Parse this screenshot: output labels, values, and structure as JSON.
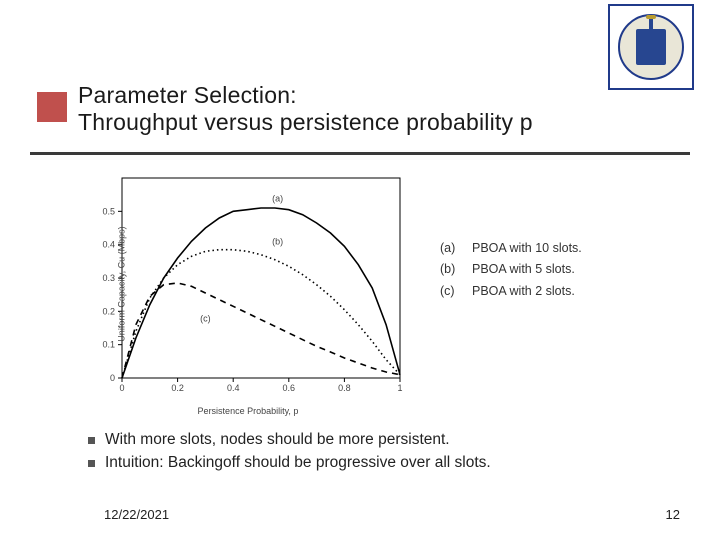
{
  "title_line1": "Parameter Selection:",
  "title_line2": "Throughput versus persistence probability p",
  "footer": {
    "date": "12/22/2021",
    "page": "12"
  },
  "bullets": [
    "With more slots, nodes should be more persistent.",
    "Intuition: Backingoff should be progressive over all slots."
  ],
  "legend": [
    {
      "key": "(a)",
      "text": "PBOA with 10 slots."
    },
    {
      "key": "(b)",
      "text": "PBOA with 5 slots."
    },
    {
      "key": "(c)",
      "text": "PBOA with 2 slots."
    }
  ],
  "chart_data": {
    "type": "line",
    "xlabel": "Persistence Probability, p",
    "ylabel": "Uniform Capacity, Cu (Mbps)",
    "xlim": [
      0,
      1
    ],
    "ylim": [
      0,
      0.6
    ],
    "xticks": [
      0,
      0.2,
      0.4,
      0.6,
      0.8,
      1
    ],
    "yticks": [
      0,
      0.1,
      0.2,
      0.3,
      0.4,
      0.5
    ],
    "inplot_labels": [
      {
        "text": "(a)",
        "x": 0.56,
        "y": 0.53
      },
      {
        "text": "(b)",
        "x": 0.56,
        "y": 0.4
      },
      {
        "text": "(c)",
        "x": 0.3,
        "y": 0.17
      }
    ],
    "series": [
      {
        "name": "(a) PBOA with 10 slots",
        "style": "solid",
        "x": [
          0.0,
          0.05,
          0.1,
          0.15,
          0.2,
          0.25,
          0.3,
          0.35,
          0.4,
          0.45,
          0.5,
          0.55,
          0.6,
          0.65,
          0.7,
          0.75,
          0.8,
          0.85,
          0.9,
          0.95,
          1.0
        ],
        "values": [
          0.0,
          0.12,
          0.22,
          0.3,
          0.36,
          0.41,
          0.45,
          0.48,
          0.5,
          0.505,
          0.51,
          0.51,
          0.505,
          0.49,
          0.465,
          0.435,
          0.395,
          0.34,
          0.27,
          0.16,
          0.01
        ]
      },
      {
        "name": "(b) PBOA with 5 slots",
        "style": "dotted",
        "x": [
          0.0,
          0.05,
          0.1,
          0.15,
          0.2,
          0.25,
          0.3,
          0.35,
          0.4,
          0.45,
          0.5,
          0.55,
          0.6,
          0.65,
          0.7,
          0.75,
          0.8,
          0.85,
          0.9,
          0.95,
          1.0
        ],
        "values": [
          0.0,
          0.14,
          0.24,
          0.3,
          0.34,
          0.365,
          0.38,
          0.385,
          0.385,
          0.38,
          0.37,
          0.355,
          0.335,
          0.31,
          0.28,
          0.245,
          0.205,
          0.16,
          0.11,
          0.055,
          0.01
        ]
      },
      {
        "name": "(c) PBOA with 2 slots",
        "style": "dashed",
        "x": [
          0.0,
          0.05,
          0.1,
          0.15,
          0.2,
          0.25,
          0.3,
          0.35,
          0.4,
          0.45,
          0.5,
          0.55,
          0.6,
          0.65,
          0.7,
          0.75,
          0.8,
          0.85,
          0.9,
          0.95,
          1.0
        ],
        "values": [
          0.0,
          0.16,
          0.245,
          0.28,
          0.285,
          0.275,
          0.255,
          0.235,
          0.215,
          0.195,
          0.175,
          0.155,
          0.135,
          0.115,
          0.095,
          0.078,
          0.06,
          0.045,
          0.03,
          0.018,
          0.01
        ]
      }
    ]
  }
}
